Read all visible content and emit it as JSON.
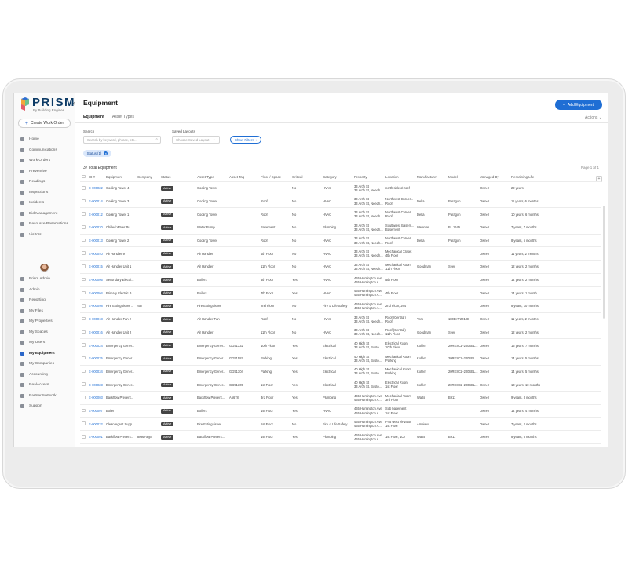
{
  "brand": {
    "name": "PRISM",
    "tagline": "By Building Engines"
  },
  "sidebar": {
    "create_label": "Create Work Order",
    "items": [
      {
        "label": "Home"
      },
      {
        "label": "Communications"
      },
      {
        "label": "Work Orders"
      },
      {
        "label": "Preventive"
      },
      {
        "label": "Readings"
      },
      {
        "label": "Inspections"
      },
      {
        "label": "Incidents"
      },
      {
        "label": "Bid Management"
      },
      {
        "label": "Resource Reservations"
      },
      {
        "label": "Visitors"
      }
    ],
    "bottom_items": [
      {
        "label": "Prism Admin"
      },
      {
        "label": "Admin"
      },
      {
        "label": "Reporting"
      },
      {
        "label": "My Files"
      },
      {
        "label": "My Properties"
      },
      {
        "label": "My Spaces"
      },
      {
        "label": "My Users"
      },
      {
        "label": "My Equipment",
        "active": true
      },
      {
        "label": "My Companies"
      },
      {
        "label": "Accounting"
      },
      {
        "label": "RealAccess"
      },
      {
        "label": "Partner Network"
      },
      {
        "label": "Support"
      }
    ]
  },
  "header": {
    "title": "Equipment",
    "add_label": "Add Equipment",
    "actions_label": "Actions"
  },
  "tabs": [
    {
      "label": "Equipment",
      "active": true
    },
    {
      "label": "Asset Types"
    }
  ],
  "filters": {
    "search_label": "Search",
    "search_placeholder": "Search by keyword, phrase, etc...",
    "saved_label": "Saved Layouts",
    "saved_placeholder": "Choose Saved Layout",
    "show_filters_label": "Show Filters",
    "chip_label": "Status (1)"
  },
  "summary": {
    "total": "37 Total Equipment",
    "page": "Page 1 of 1"
  },
  "columns": [
    "ID #",
    "Equipment",
    "Company",
    "Status",
    "Asset Type",
    "Asset Tag",
    "Floor / Space",
    "Critical",
    "Category",
    "Property",
    "Location",
    "Manufacturer",
    "Model",
    "Managed By",
    "Remaining Life"
  ],
  "rows": [
    {
      "id": "E-000022",
      "equipment": "Cooling Tower 4",
      "company": "",
      "status": "Active",
      "asset_type": "Cooling Tower",
      "asset_tag": "",
      "floor": "",
      "critical": "No",
      "category": "HVAC",
      "property1": "33 Arch St",
      "property2": "33 Arch St, Needh...",
      "location1": "north side of roof",
      "location2": "",
      "manufacturer": "",
      "model": "",
      "managed_by": "Owner",
      "remaining_life": "22 years"
    },
    {
      "id": "E-000014",
      "equipment": "Cooling Tower 3",
      "company": "",
      "status": "Active",
      "asset_type": "Cooling Tower",
      "asset_tag": "",
      "floor": "Roof",
      "critical": "No",
      "category": "HVAC",
      "property1": "33 Arch St",
      "property2": "33 Arch St, Needh...",
      "location1": "Northwest Corner...",
      "location2": "Roof",
      "manufacturer": "Delta",
      "model": "Paragon",
      "managed_by": "Owner",
      "remaining_life": "11 years, 6 months"
    },
    {
      "id": "E-000012",
      "equipment": "Cooling Tower 1",
      "company": "",
      "status": "Active",
      "asset_type": "Cooling Tower",
      "asset_tag": "",
      "floor": "Roof",
      "critical": "No",
      "category": "HVAC",
      "property1": "33 Arch St",
      "property2": "33 Arch St, Needh...",
      "location1": "Northwest Corner...",
      "location2": "Roof",
      "manufacturer": "Delta",
      "model": "Paragon",
      "managed_by": "Owner",
      "remaining_life": "10 years, 6 months"
    },
    {
      "id": "E-000020",
      "equipment": "Chilled Water Pu...",
      "company": "",
      "status": "Active",
      "asset_type": "Water Pump",
      "asset_tag": "",
      "floor": "Basement",
      "critical": "No",
      "category": "Plumbing",
      "property1": "33 Arch St",
      "property2": "33 Arch St, Needh...",
      "location1": "Southwest Basem...",
      "location2": "Basement",
      "manufacturer": "Weeman",
      "model": "BL 1645",
      "managed_by": "Owner",
      "remaining_life": "7 years, 7 months"
    },
    {
      "id": "E-000013",
      "equipment": "Cooling Tower 2",
      "company": "",
      "status": "Active",
      "asset_type": "Cooling Tower",
      "asset_tag": "",
      "floor": "Roof",
      "critical": "No",
      "category": "HVAC",
      "property1": "33 Arch St",
      "property2": "33 Arch St, Needh...",
      "location1": "Northwest Corner...",
      "location2": "Roof",
      "manufacturer": "Delta",
      "model": "Paragon",
      "managed_by": "Owner",
      "remaining_life": "8 years, 6 months"
    },
    {
      "id": "E-000040",
      "equipment": "Air Handler 9",
      "company": "",
      "status": "Active",
      "asset_type": "Air Handler",
      "asset_tag": "",
      "floor": "4th Floor",
      "critical": "No",
      "category": "HVAC",
      "property1": "33 Arch St",
      "property2": "33 Arch St, Needh...",
      "location1": "Mechanical Closet",
      "location2": "4th Floor",
      "manufacturer": "",
      "model": "",
      "managed_by": "Owner",
      "remaining_life": "11 years, 2 months"
    },
    {
      "id": "E-000015",
      "equipment": "Air Handler Unit 1",
      "company": "",
      "status": "Active",
      "asset_type": "Air Handler",
      "asset_tag": "",
      "floor": "11th Floor",
      "critical": "No",
      "category": "HVAC",
      "property1": "33 Arch St",
      "property2": "33 Arch St, Needh...",
      "location1": "Mechanical Room",
      "location2": "11th Floor",
      "manufacturer": "Goodman",
      "model": "Seer",
      "managed_by": "Owner",
      "remaining_life": "12 years, 2 months"
    },
    {
      "id": "E-000005",
      "equipment": "Secondary Electri...",
      "company": "",
      "status": "Active",
      "asset_type": "Boilers",
      "asset_tag": "",
      "floor": "5th Floor",
      "critical": "Yes",
      "category": "HVAC",
      "property1": "465 Huntington Ave",
      "property2": "465 Huntington A...",
      "location1": "5th Floor",
      "location2": "",
      "manufacturer": "",
      "model": "",
      "managed_by": "Owner",
      "remaining_life": "14 years, 2 months"
    },
    {
      "id": "E-000004",
      "equipment": "Primary Electric B...",
      "company": "",
      "status": "Active",
      "asset_type": "Boilers",
      "asset_tag": "",
      "floor": "4th Floor",
      "critical": "Yes",
      "category": "HVAC",
      "property1": "465 Huntington Ave",
      "property2": "465 Huntington A...",
      "location1": "4th Floor",
      "location2": "",
      "manufacturer": "",
      "model": "",
      "managed_by": "Owner",
      "remaining_life": "14 years, 1 month"
    },
    {
      "id": "E-000098",
      "equipment": "Fire Extinguisher ...",
      "company": "Van",
      "status": "Active",
      "asset_type": "Fire Extinguisher",
      "asset_tag": "",
      "floor": "2nd Floor",
      "critical": "No",
      "category": "Fire & Life Safety",
      "property1": "465 Huntington Ave",
      "property2": "465 Huntington A...",
      "location1": "2nd Floor, 204",
      "location2": "",
      "manufacturer": "",
      "model": "",
      "managed_by": "Owner",
      "remaining_life": "8 years, 10 months"
    },
    {
      "id": "E-000018",
      "equipment": "Air Handler Fan 2",
      "company": "",
      "status": "Active",
      "asset_type": "Air Handler Fan",
      "asset_tag": "",
      "floor": "Roof",
      "critical": "No",
      "category": "HVAC",
      "property1": "33 Arch St",
      "property2": "33 Arch St, Needh...",
      "location1": "Roof (Central)",
      "location2": "Roof",
      "manufacturer": "York",
      "model": "180DAF2019E",
      "managed_by": "Owner",
      "remaining_life": "11 years, 2 months"
    },
    {
      "id": "E-000016",
      "equipment": "Air Handler Unit 2",
      "company": "",
      "status": "Active",
      "asset_type": "Air Handler",
      "asset_tag": "",
      "floor": "11th Floor",
      "critical": "No",
      "category": "HVAC",
      "property1": "33 Arch St",
      "property2": "33 Arch St, Needh...",
      "location1": "Roof (Central)",
      "location2": "11th Floor",
      "manufacturer": "Goodman",
      "model": "Seer",
      "managed_by": "Owner",
      "remaining_life": "12 years, 2 months"
    },
    {
      "id": "E-000024",
      "equipment": "Emergency Gener...",
      "company": "",
      "status": "Active",
      "asset_type": "Emergency Gener...",
      "asset_tag": "GG51332",
      "floor": "10th Floor",
      "critical": "Yes",
      "category": "Electrical",
      "property1": "40 High St",
      "property2": "33 Arch St, Bosto...",
      "location1": "Electrical Room",
      "location2": "10th Floor",
      "manufacturer": "Kohler",
      "model": "20RESCL-200SEL...",
      "managed_by": "Owner",
      "remaining_life": "15 years, 7 months"
    },
    {
      "id": "E-000025",
      "equipment": "Emergency Gener...",
      "company": "",
      "status": "Active",
      "asset_type": "Emergency Gener...",
      "asset_tag": "GG51587",
      "floor": "Parking",
      "critical": "Yes",
      "category": "Electrical",
      "property1": "40 High St",
      "property2": "33 Arch St, Bosto...",
      "location1": "Mechanical Room",
      "location2": "Parking",
      "manufacturer": "Kohler",
      "model": "20RESCL-200SEL...",
      "managed_by": "Owner",
      "remaining_life": "14 years, 5 months"
    },
    {
      "id": "E-000034",
      "equipment": "Emergency Gener...",
      "company": "",
      "status": "Active",
      "asset_type": "Emergency Gener...",
      "asset_tag": "GG51304",
      "floor": "Parking",
      "critical": "Yes",
      "category": "Electrical",
      "property1": "40 High St",
      "property2": "33 Arch St, Bosto...",
      "location1": "Mechanical Room",
      "location2": "Parking",
      "manufacturer": "Kohler",
      "model": "20RESCL-200SEL...",
      "managed_by": "Owner",
      "remaining_life": "14 years, 5 months"
    },
    {
      "id": "E-000023",
      "equipment": "Emergency Gener...",
      "company": "",
      "status": "Active",
      "asset_type": "Emergency Gener...",
      "asset_tag": "GG51305",
      "floor": "1st Floor",
      "critical": "Yes",
      "category": "Electrical",
      "property1": "40 High St",
      "property2": "33 Arch St, Bosto...",
      "location1": "Electrical Room",
      "location2": "1st Floor",
      "manufacturer": "Kohler",
      "model": "20RESCL-200SEL...",
      "managed_by": "Owner",
      "remaining_life": "13 years, 10 months"
    },
    {
      "id": "E-000003",
      "equipment": "Backflow Prevent...",
      "company": "",
      "status": "Active",
      "asset_type": "Backflow Prevent...",
      "asset_tag": "A5678",
      "floor": "3rd Floor",
      "critical": "Yes",
      "category": "Plumbing",
      "property1": "465 Huntington Ave",
      "property2": "465 Huntington A...",
      "location1": "Mechanical Room",
      "location2": "3rd Floor",
      "manufacturer": "Watts",
      "model": "B911",
      "managed_by": "Owner",
      "remaining_life": "9 years, 8 months"
    },
    {
      "id": "E-000007",
      "equipment": "Boiler",
      "company": "",
      "status": "Active",
      "asset_type": "Boilers",
      "asset_tag": "",
      "floor": "1st Floor",
      "critical": "Yes",
      "category": "HVAC",
      "property1": "465 Huntington Ave",
      "property2": "465 Huntington A...",
      "location1": "Sub basement",
      "location2": "1st Floor",
      "manufacturer": "",
      "model": "",
      "managed_by": "Owner",
      "remaining_life": "14 years, 4 months"
    },
    {
      "id": "E-000032",
      "equipment": "Clean Agent Supp...",
      "company": "",
      "status": "Active",
      "asset_type": "Fire Extinguisher",
      "asset_tag": "",
      "floor": "1st Floor",
      "critical": "No",
      "category": "Fire & Life Safety",
      "property1": "465 Huntington Ave",
      "property2": "465 Huntington A...",
      "location1": "P45 west elevator",
      "location2": "1st Floor",
      "manufacturer": "Ameirex",
      "model": "",
      "managed_by": "Owner",
      "remaining_life": "7 years, 2 months"
    },
    {
      "id": "E-000001",
      "equipment": "Backflow Prevent...",
      "company": "Bellis Fargo",
      "status": "Active",
      "asset_type": "Backflow Prevent...",
      "asset_tag": "",
      "floor": "1st Floor",
      "critical": "Yes",
      "category": "Plumbing",
      "property1": "465 Huntington Ave",
      "property2": "465 Huntington A...",
      "location1": "1st Floor, 100",
      "location2": "",
      "manufacturer": "Watts",
      "model": "B911",
      "managed_by": "Owner",
      "remaining_life": "8 years, 6 months"
    }
  ]
}
